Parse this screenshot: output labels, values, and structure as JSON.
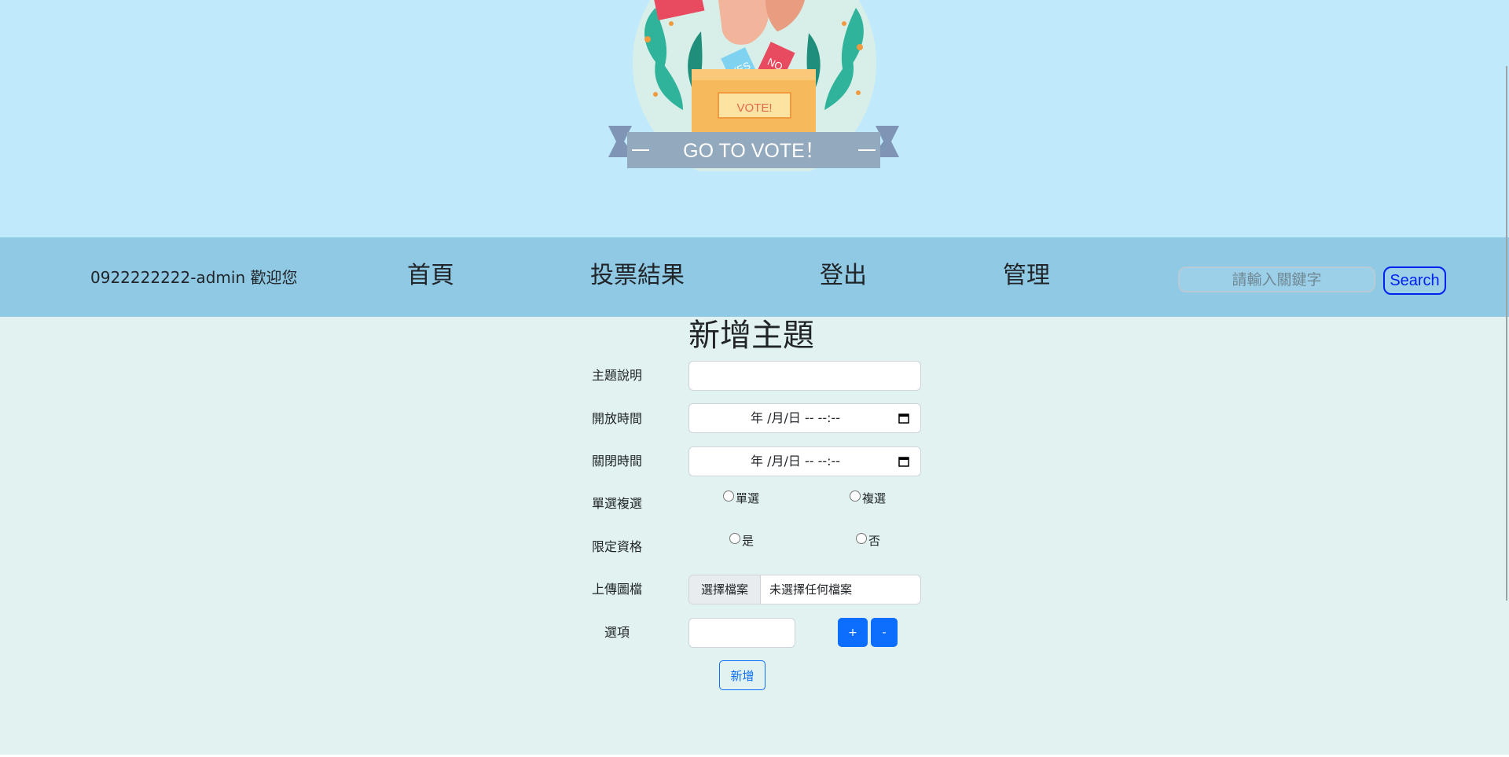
{
  "banner": {
    "logo_text": "GO TO VOTE！",
    "ballot_yes": "YES",
    "ballot_no": "NO",
    "box_text": "VOTE!"
  },
  "nav": {
    "welcome": "0922222222-admin 歡迎您",
    "links": [
      "首頁",
      "投票結果",
      "登出",
      "管理"
    ],
    "search_placeholder": "請輸入關鍵字",
    "search_button": "Search"
  },
  "form": {
    "title": "新增主題",
    "labels": {
      "subject": "主題說明",
      "open_time": "開放時間",
      "close_time": "關閉時間",
      "select_type": "單選複選",
      "restrict": "限定資格",
      "upload": "上傳圖檔",
      "option": "選項"
    },
    "subject_value": "",
    "open_time_value": "年 /月/日 -- --:--",
    "close_time_value": "年 /月/日 -- --:--",
    "select_type_options": [
      "單選",
      "複選"
    ],
    "restrict_options": [
      "是",
      "否"
    ],
    "file_button": "選擇檔案",
    "file_status": "未選擇任何檔案",
    "option_value": "",
    "add_option_button": "+",
    "remove_option_button": "-",
    "submit_button": "新增"
  }
}
